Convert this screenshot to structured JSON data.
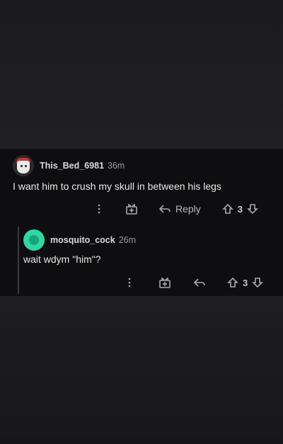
{
  "comment": {
    "username": "This_Bed_6981",
    "time": "36m",
    "text": "I want him to crush my skull in between his legs",
    "reply_label": "Reply",
    "score": "3"
  },
  "reply": {
    "username": "mosquito_cock",
    "time": "26m",
    "text": "wait wdym \"him\"?",
    "score": "3"
  },
  "colors": {
    "background": "#1b1b1d",
    "thread_bg": "#0e0e10",
    "reply_avatar": "#2ed8a3",
    "muted": "#a8aaae"
  },
  "icons": [
    "more-icon",
    "award-icon",
    "reply-icon",
    "upvote-icon",
    "downvote-icon"
  ]
}
